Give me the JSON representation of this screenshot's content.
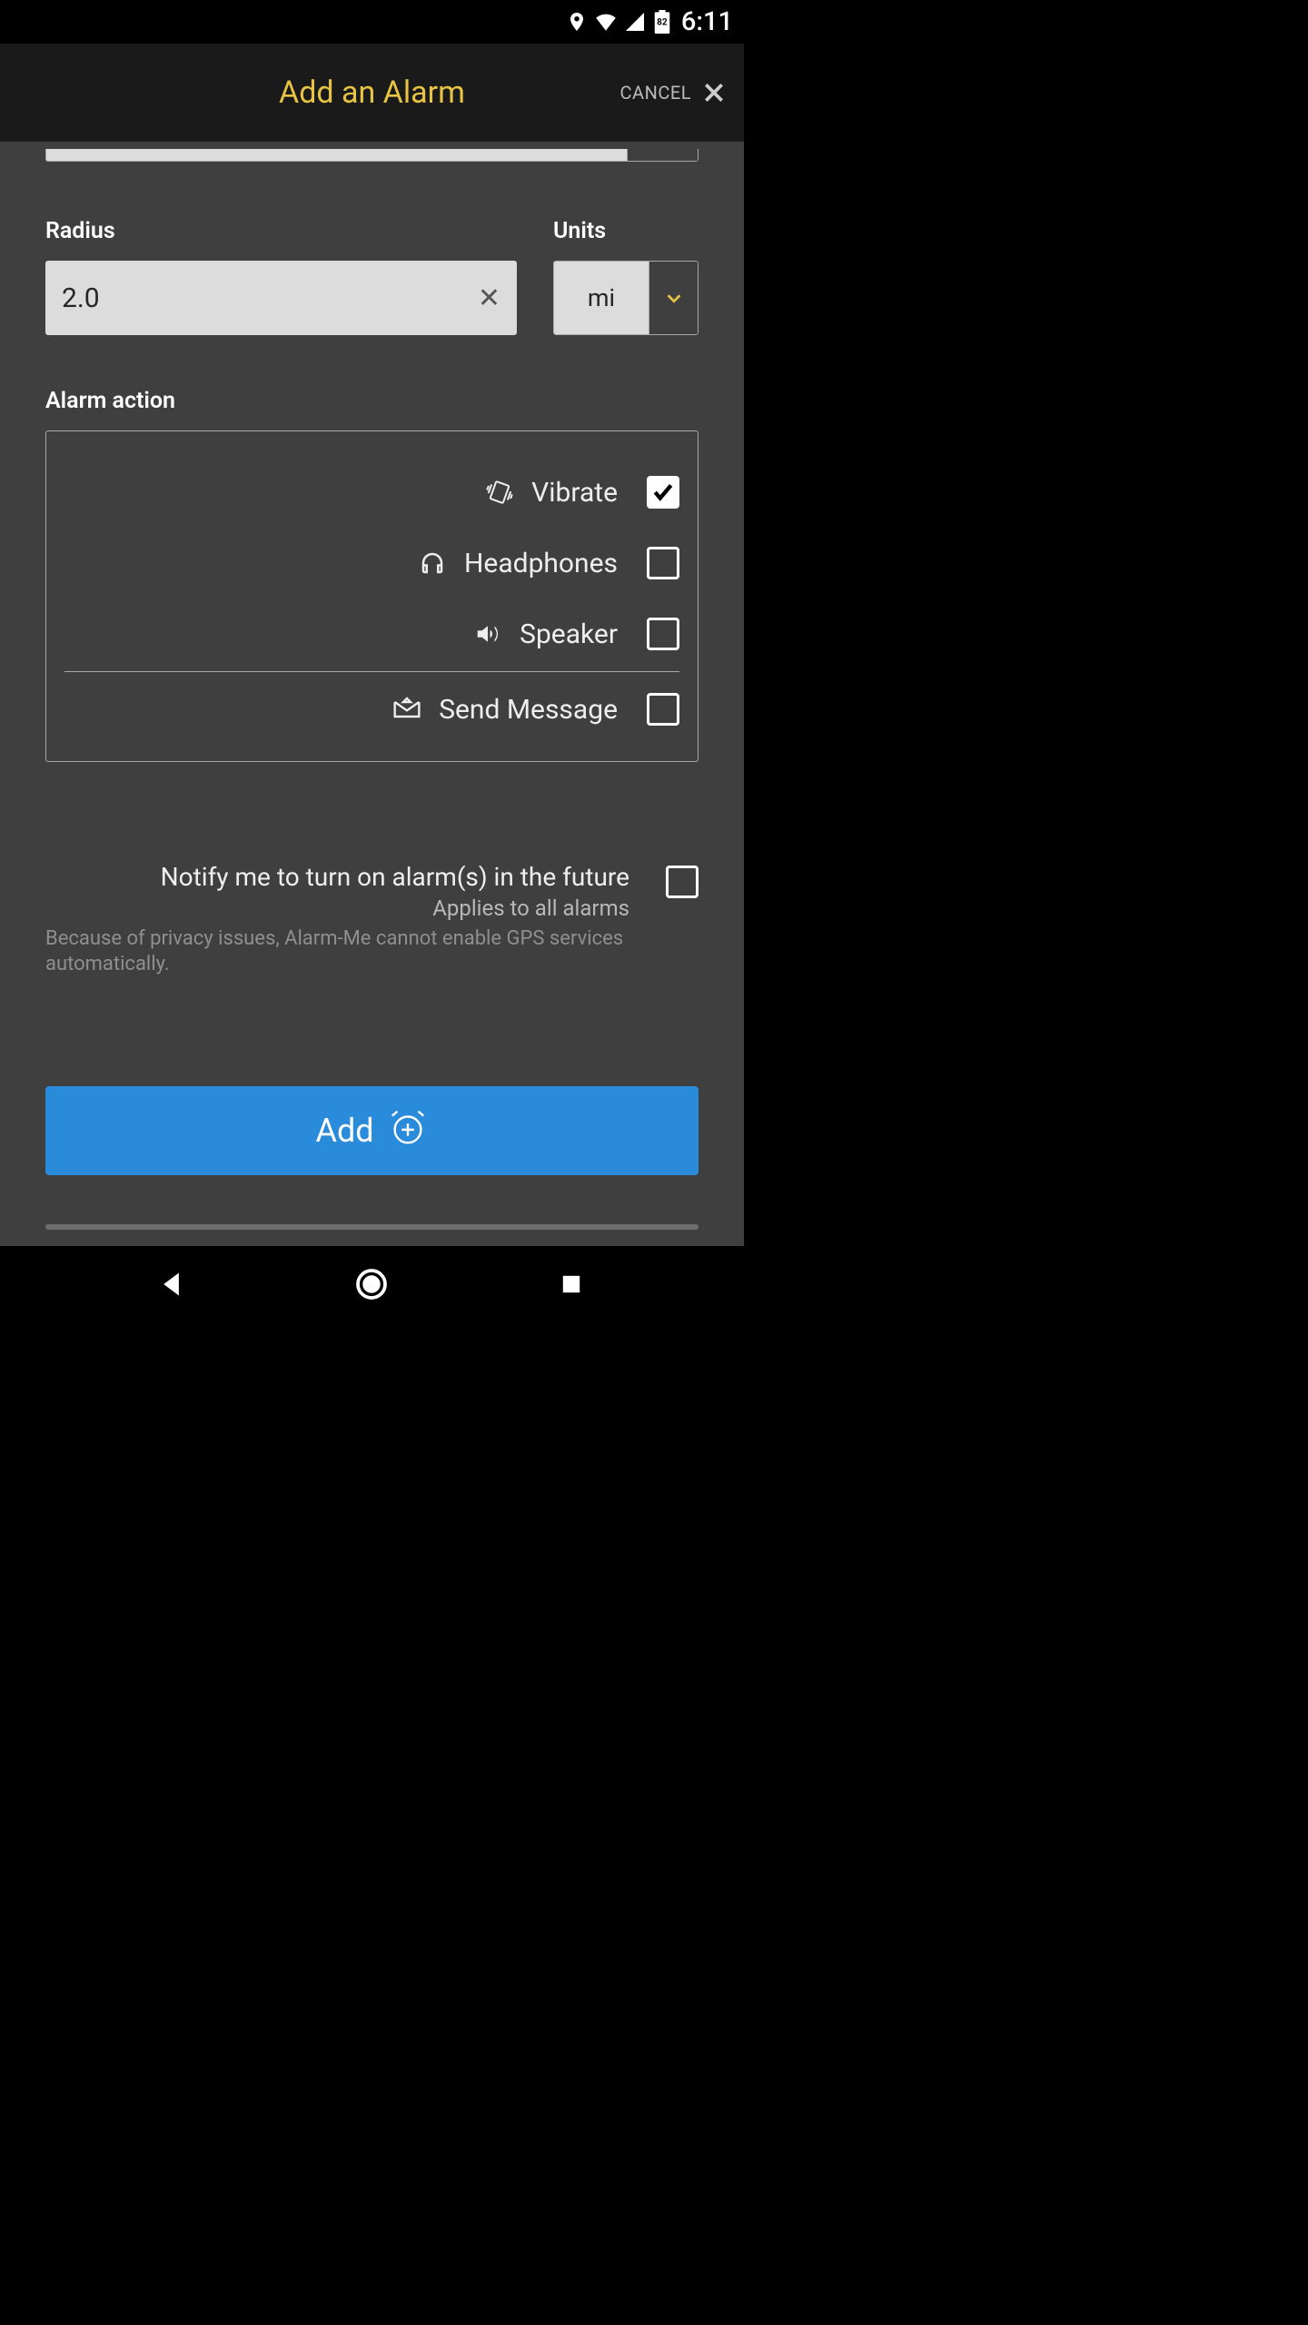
{
  "status_bar": {
    "battery_level": "82",
    "time": "6:11"
  },
  "app_bar": {
    "title": "Add an Alarm",
    "cancel": "CANCEL"
  },
  "radius": {
    "label": "Radius",
    "value": "2.0"
  },
  "units": {
    "label": "Units",
    "value": "mi"
  },
  "alarm_action": {
    "label": "Alarm action",
    "items": [
      {
        "icon": "vibrate-icon",
        "label": "Vibrate",
        "checked": true
      },
      {
        "icon": "headphones-icon",
        "label": "Headphones",
        "checked": false
      },
      {
        "icon": "speaker-icon",
        "label": "Speaker",
        "checked": false
      },
      {
        "icon": "message-icon",
        "label": "Send Message",
        "checked": false
      }
    ]
  },
  "notify": {
    "title": "Notify me to turn on alarm(s) in the future",
    "subtitle": "Applies to all alarms",
    "footnote": "Because of privacy issues, Alarm-Me cannot enable GPS services automatically.",
    "checked": false
  },
  "add_button": {
    "label": "Add"
  }
}
